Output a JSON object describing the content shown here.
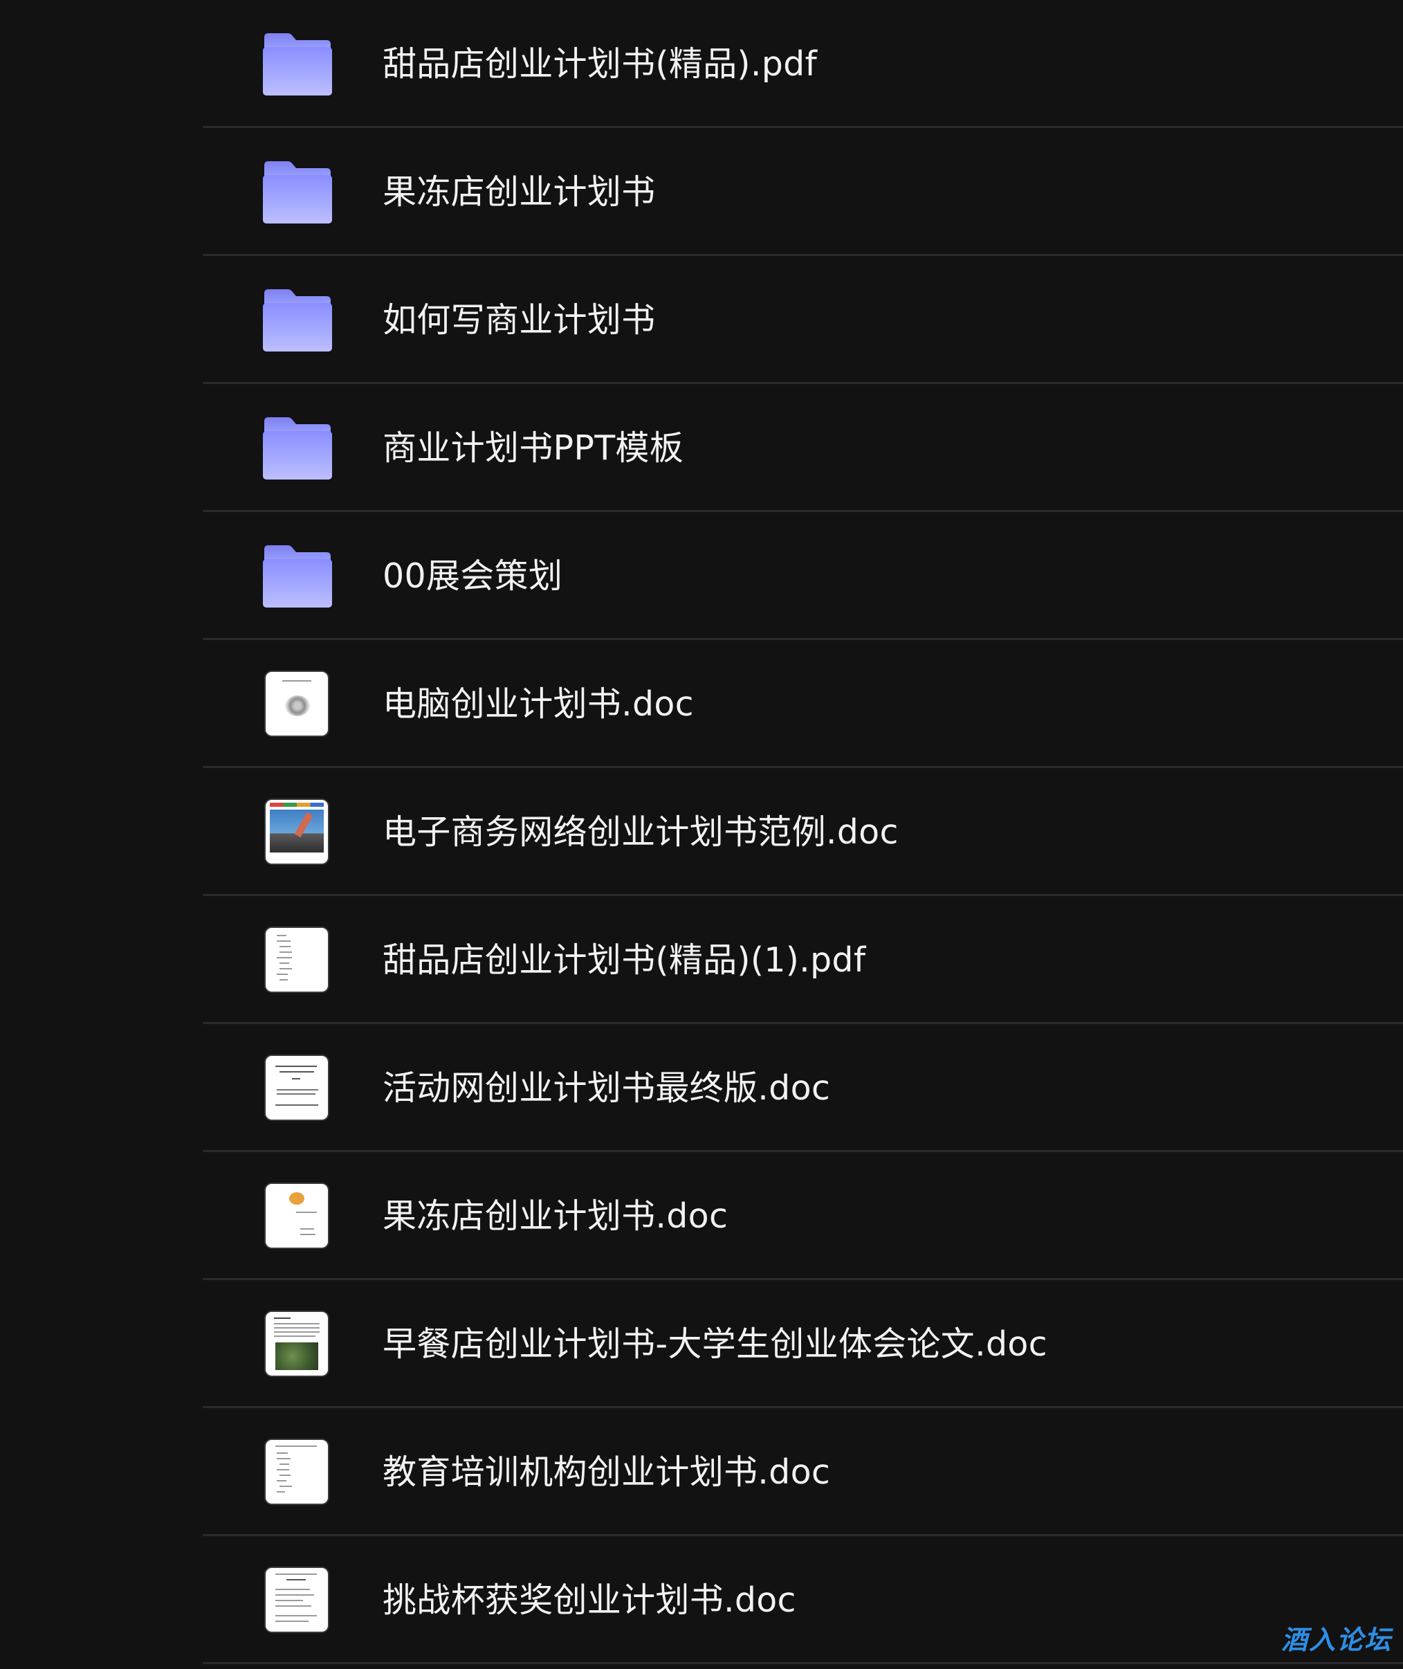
{
  "files": [
    {
      "name": "甜品店创业计划书(精品).pdf",
      "kind": "folder",
      "icon": "folder-icon"
    },
    {
      "name": "果冻店创业计划书",
      "kind": "folder",
      "icon": "folder-icon"
    },
    {
      "name": "如何写商业计划书",
      "kind": "folder",
      "icon": "folder-icon"
    },
    {
      "name": "商业计划书PPT模板",
      "kind": "folder",
      "icon": "folder-icon"
    },
    {
      "name": "00展会策划",
      "kind": "folder",
      "icon": "folder-icon"
    },
    {
      "name": "电脑创业计划书.doc",
      "kind": "doc",
      "icon": "document-thumbnail-icon"
    },
    {
      "name": "电子商务网络创业计划书范例.doc",
      "kind": "doc",
      "icon": "document-thumbnail-icon"
    },
    {
      "name": "甜品店创业计划书(精品)(1).pdf",
      "kind": "doc",
      "icon": "document-thumbnail-icon"
    },
    {
      "name": "活动网创业计划书最终版.doc",
      "kind": "doc",
      "icon": "document-thumbnail-icon"
    },
    {
      "name": "果冻店创业计划书.doc",
      "kind": "doc",
      "icon": "document-thumbnail-icon"
    },
    {
      "name": "早餐店创业计划书-大学生创业体会论文.doc",
      "kind": "doc",
      "icon": "document-thumbnail-icon"
    },
    {
      "name": "教育培训机构创业计划书.doc",
      "kind": "doc",
      "icon": "document-thumbnail-icon"
    },
    {
      "name": "挑战杯获奖创业计划书.doc",
      "kind": "doc",
      "icon": "document-thumbnail-icon"
    }
  ],
  "watermark": "酒入论坛",
  "colors": {
    "background": "#121213",
    "divider": "#2a2a2c",
    "text": "#f2f2f2",
    "folder_top": "#8f93ff",
    "folder_bottom": "#b9bcff",
    "watermark": "#2e8fe6"
  }
}
